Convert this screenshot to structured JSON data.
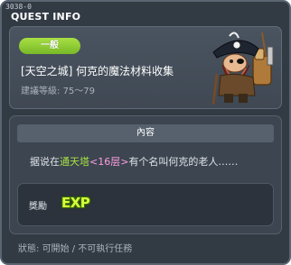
{
  "window": {
    "quest_id": "3038-0",
    "title": "QUEST INFO"
  },
  "quest": {
    "category_badge": "一般",
    "name": "[天空之城] 何克的魔法材料收集",
    "level_label": "建議等級:",
    "level_range": "75～79",
    "npc_icon": "pirate-npc-portrait"
  },
  "content": {
    "header": "內容",
    "desc_prefix": "据说在",
    "desc_place": "通天塔",
    "desc_floor": "<16层>",
    "desc_suffix": "有个名叫何克的老人……"
  },
  "reward": {
    "label": "獎勵",
    "exp_text": "EXP"
  },
  "status": {
    "label": "狀態:",
    "value": "可開始 / 不可執行任務"
  },
  "colors": {
    "window_bg": "#323a44",
    "badge_green": "#8ccc34",
    "highlight_green": "#a8e044",
    "highlight_pink": "#ff9ee0"
  }
}
